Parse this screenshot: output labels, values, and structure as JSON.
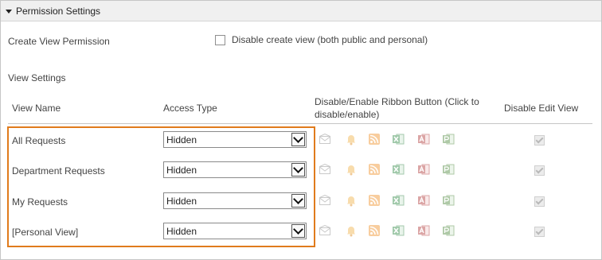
{
  "panel": {
    "title": "Permission Settings"
  },
  "create_view": {
    "label": "Create View Permission",
    "checkbox_label": "Disable create view (both public and personal)",
    "checked": false
  },
  "view_settings": {
    "label": "View Settings"
  },
  "columns": {
    "view_name": "View Name",
    "access_type": "Access Type",
    "ribbon_line1": "Disable/Enable Ribbon Button (Click to",
    "ribbon_line2": "disable/enable)",
    "disable_edit": "Disable Edit View"
  },
  "views": [
    {
      "name": "All Requests",
      "access": "Hidden"
    },
    {
      "name": "Department Requests",
      "access": "Hidden"
    },
    {
      "name": "My Requests",
      "access": "Hidden"
    },
    {
      "name": "[Personal View]",
      "access": "Hidden"
    }
  ],
  "ribbon_icons": [
    "email-icon",
    "alert-bell-icon",
    "rss-icon",
    "excel-icon",
    "access-icon",
    "project-icon"
  ],
  "colors": {
    "highlight": "#e07b1c"
  }
}
